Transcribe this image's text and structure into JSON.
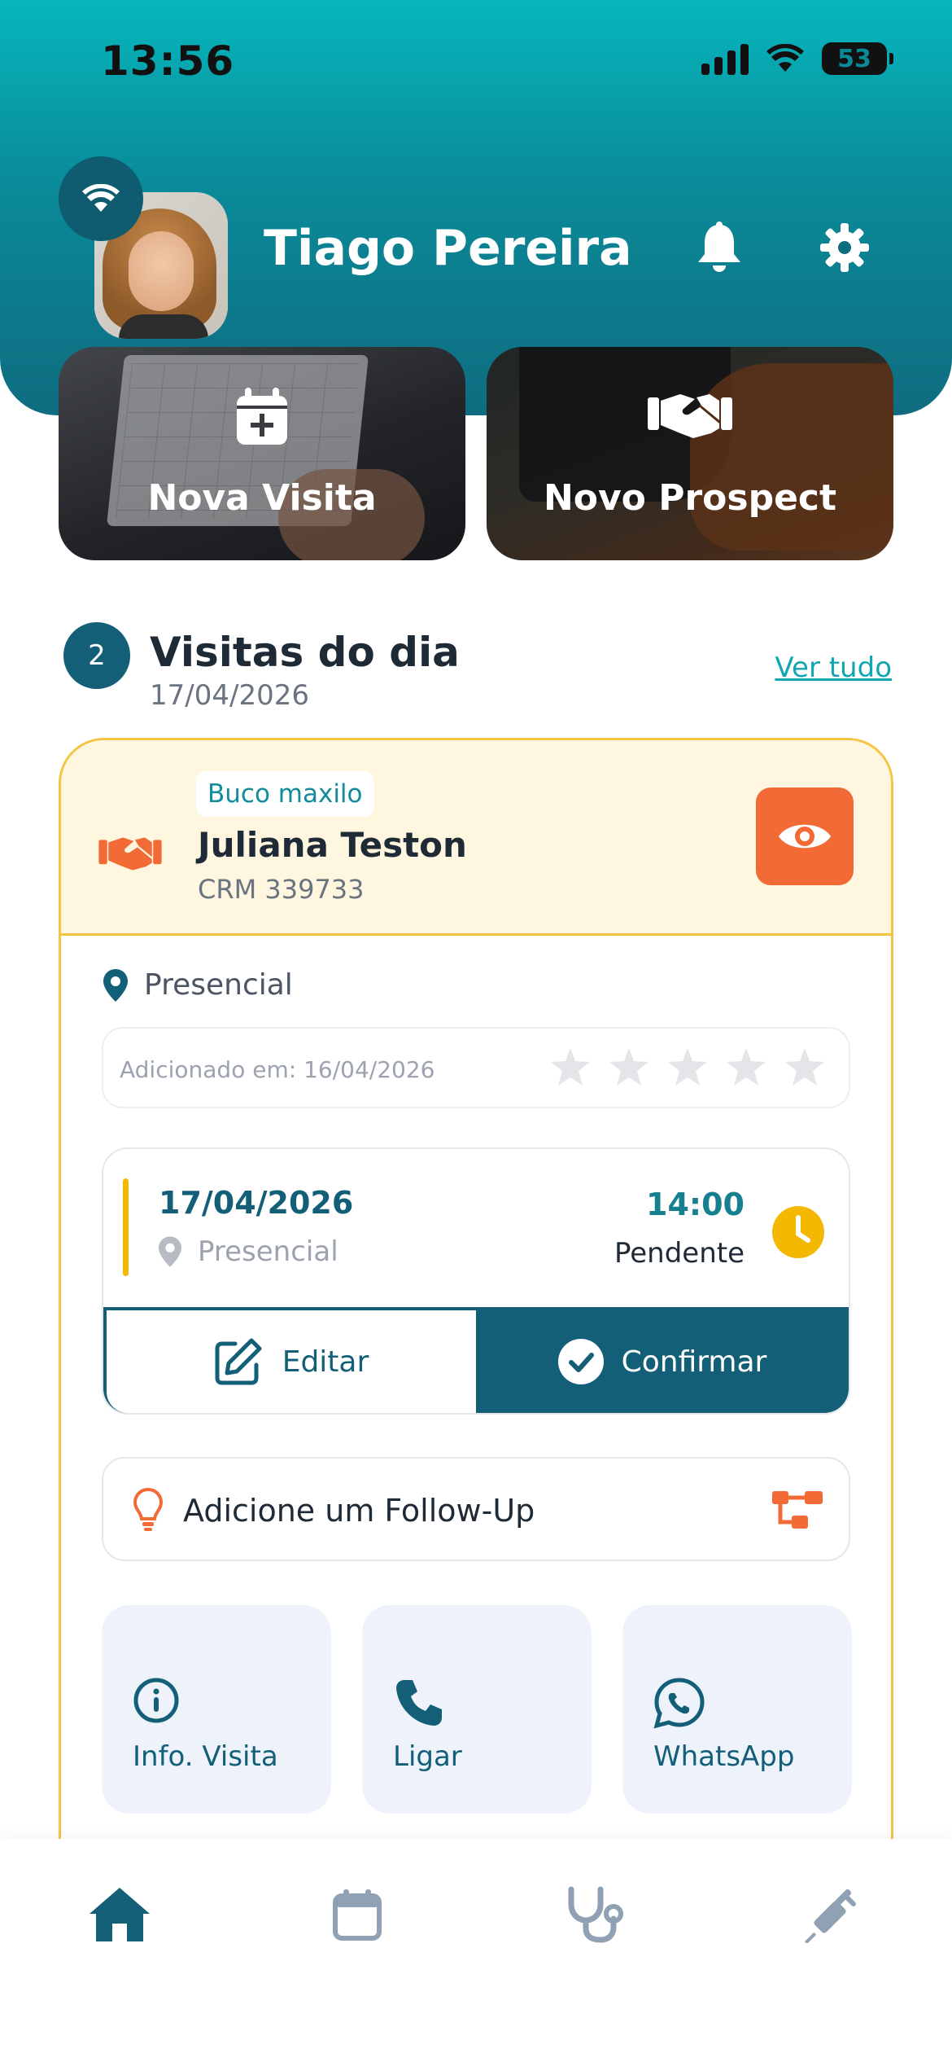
{
  "status_bar": {
    "time": "13:56",
    "battery": "53"
  },
  "colors": {
    "primary": "#135f78",
    "accent_teal": "#11a6b2",
    "orange": "#f26a35",
    "amber": "#f4b800",
    "card_border": "#f4c542"
  },
  "header": {
    "user_name": "Tiago Pereira",
    "icons": [
      "wifi-icon",
      "bell-icon",
      "gear-icon"
    ]
  },
  "tiles": [
    {
      "label": "Nova Visita",
      "icon": "calendar-plus-icon"
    },
    {
      "label": "Novo Prospect",
      "icon": "handshake-icon"
    }
  ],
  "section": {
    "count": "2",
    "title": "Visitas do dia",
    "date": "17/04/2026",
    "see_all": "Ver tudo"
  },
  "visit": {
    "specialty": "Buco maxilo",
    "doctor_name": "Juliana Teston",
    "crm": "CRM 339733",
    "modality": "Presencial",
    "added_text": "Adicionado em: 16/04/2026",
    "rating": 0,
    "rating_max": 5,
    "appointment": {
      "date": "17/04/2026",
      "location": "Presencial",
      "time": "14:00",
      "status": "Pendente",
      "edit_label": "Editar",
      "confirm_label": "Confirmar"
    },
    "followup_label": "Adicione um Follow-Up",
    "quick_actions": [
      {
        "label": "Info. Visita",
        "icon": "info-icon"
      },
      {
        "label": "Ligar",
        "icon": "phone-icon"
      },
      {
        "label": "WhatsApp",
        "icon": "whatsapp-icon"
      }
    ]
  },
  "bottom_nav": [
    {
      "icon": "home-icon",
      "active": true
    },
    {
      "icon": "calendar-icon",
      "active": false
    },
    {
      "icon": "stethoscope-icon",
      "active": false
    },
    {
      "icon": "syringe-icon",
      "active": false
    }
  ]
}
